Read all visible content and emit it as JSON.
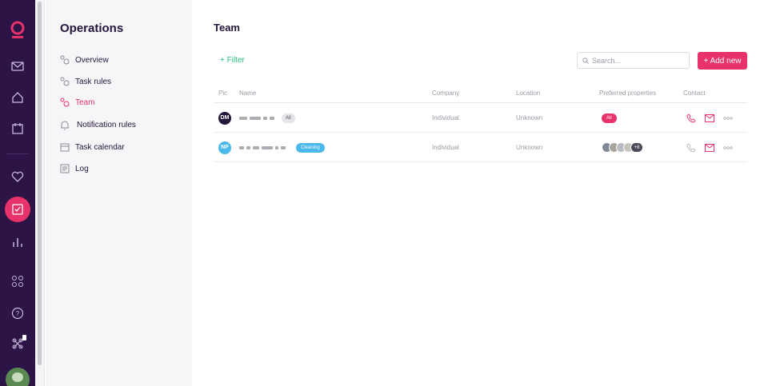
{
  "rail": {
    "icons": [
      "logo-icon",
      "mail-icon",
      "home-icon",
      "calendar-icon",
      "heart-icon",
      "tasks-icon",
      "analytics-icon",
      "apps-icon",
      "help-icon",
      "integrations-icon"
    ],
    "accent": "#e8326b",
    "background": "#2d1446"
  },
  "sidebar": {
    "title": "Operations",
    "items": [
      {
        "label": "Overview",
        "icon": "people-icon"
      },
      {
        "label": "Task rules",
        "icon": "people-icon"
      },
      {
        "label": "Team",
        "icon": "people-icon",
        "active": true
      },
      {
        "label": "Notification rules",
        "icon": "bell-icon"
      },
      {
        "label": "Task calendar",
        "icon": "calendar-icon"
      },
      {
        "label": "Log",
        "icon": "log-icon"
      }
    ]
  },
  "main": {
    "title": "Team",
    "filter_label": "+ Filter",
    "search_placeholder": "Search...",
    "add_label": "+ Add new",
    "columns": [
      "Pic",
      "Name",
      "Company",
      "Location",
      "Preferred properties",
      "Contact"
    ],
    "rows": [
      {
        "initials": "DM",
        "avatar_color": "#24163a",
        "tag": "All",
        "company": "Individual",
        "location": "Unknown",
        "preferred": "All"
      },
      {
        "initials": "NP",
        "avatar_color": "#4ab8ea",
        "tag": "Cleaning",
        "company": "Individual",
        "location": "Unknown",
        "preferred_more": "+8"
      }
    ]
  }
}
